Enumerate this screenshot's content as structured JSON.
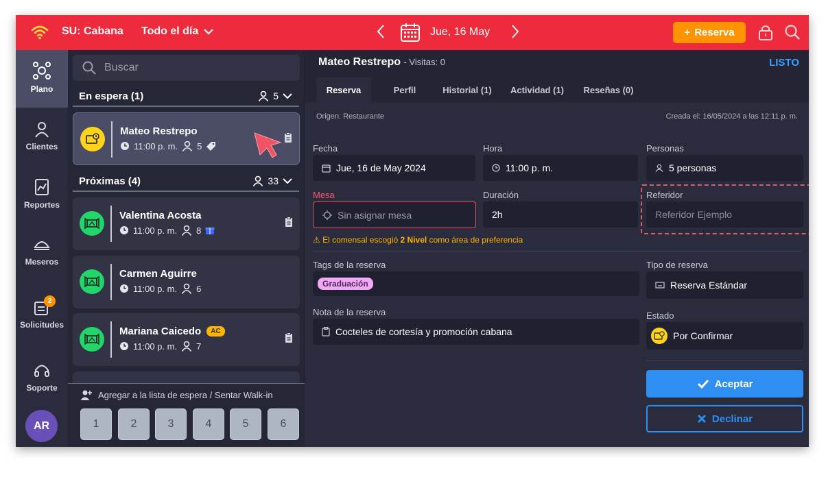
{
  "topbar": {
    "venue": "SU: Cabana",
    "period": "Todo el día",
    "date": "Jue, 16 May",
    "add_button": "Reserva",
    "colors": {
      "bar": "#ee2a3d",
      "add_button": "#ff9300"
    }
  },
  "leftnav": {
    "items": [
      {
        "label": "Plano",
        "icon": "floorplan-icon"
      },
      {
        "label": "Clientes",
        "icon": "person-icon"
      },
      {
        "label": "Reportes",
        "icon": "report-icon"
      },
      {
        "label": "Meseros",
        "icon": "waiter-icon"
      },
      {
        "label": "Solicitudes",
        "icon": "requests-icon",
        "badge": "2"
      },
      {
        "label": "Soporte",
        "icon": "headset-icon"
      }
    ],
    "avatar": "AR"
  },
  "list": {
    "search_placeholder": "Buscar",
    "waiting": {
      "title": "En espera (1)",
      "count": "5"
    },
    "upcoming": {
      "title": "Próximas (4)",
      "count": "33"
    },
    "cards": [
      {
        "name": "Mateo Restrepo",
        "time": "11:00 p. m.",
        "people": "5",
        "status_color": "#ffd31a"
      },
      {
        "name": "Valentina Acosta",
        "time": "11:00 p. m.",
        "people": "8",
        "status_color": "#22d66b"
      },
      {
        "name": "Carmen Aguirre",
        "time": "11:00 p. m.",
        "people": "6",
        "status_color": "#22d66b"
      },
      {
        "name": "Mariana Caicedo",
        "tag": "AC",
        "time": "11:00 p. m.",
        "people": "7",
        "status_color": "#22d66b"
      }
    ],
    "walkin_label": "Agregar a la lista de espera / Sentar Walk-in",
    "party_sizes": [
      "1",
      "2",
      "3",
      "4",
      "5",
      "6"
    ]
  },
  "detail": {
    "guest_name": "Mateo Restrepo",
    "visits": "- Visitas: 0",
    "status_link": "LISTO",
    "tabs": [
      "Reserva",
      "Perfil",
      "Historial (1)",
      "Actividad (1)",
      "Reseñas (0)"
    ],
    "origin": "Origen: Restaurante",
    "created": "Creada el: 16/05/2024 a las 12:11 p. m.",
    "fecha": {
      "label": "Fecha",
      "value": "Jue, 16 de May 2024"
    },
    "hora": {
      "label": "Hora",
      "value": "11:00 p. m."
    },
    "personas": {
      "label": "Personas",
      "value": "5 personas"
    },
    "mesa": {
      "label": "Mesa",
      "placeholder": "Sin asignar mesa"
    },
    "duracion": {
      "label": "Duración",
      "value": "2h"
    },
    "referidor": {
      "label": "Referidor",
      "placeholder": "Referidor Ejemplo"
    },
    "warning": {
      "pre": "El comensal escogió",
      "bold": "2 Nivel",
      "post": "como área de preferencia"
    },
    "tags": {
      "label": "Tags de la reserva",
      "chip": "Graduación"
    },
    "tipo": {
      "label": "Tipo de reserva",
      "value": "Reserva Estándar"
    },
    "nota": {
      "label": "Nota de la reserva",
      "value": "Cocteles de cortesía y promoción cabana"
    },
    "estado": {
      "label": "Estado",
      "value": "Por Confirmar"
    },
    "accept": "Aceptar",
    "decline": "Declinar",
    "colors": {
      "primary": "#2f8ef2",
      "warning": "#ffb400",
      "tag": "#f2a8f5"
    }
  }
}
